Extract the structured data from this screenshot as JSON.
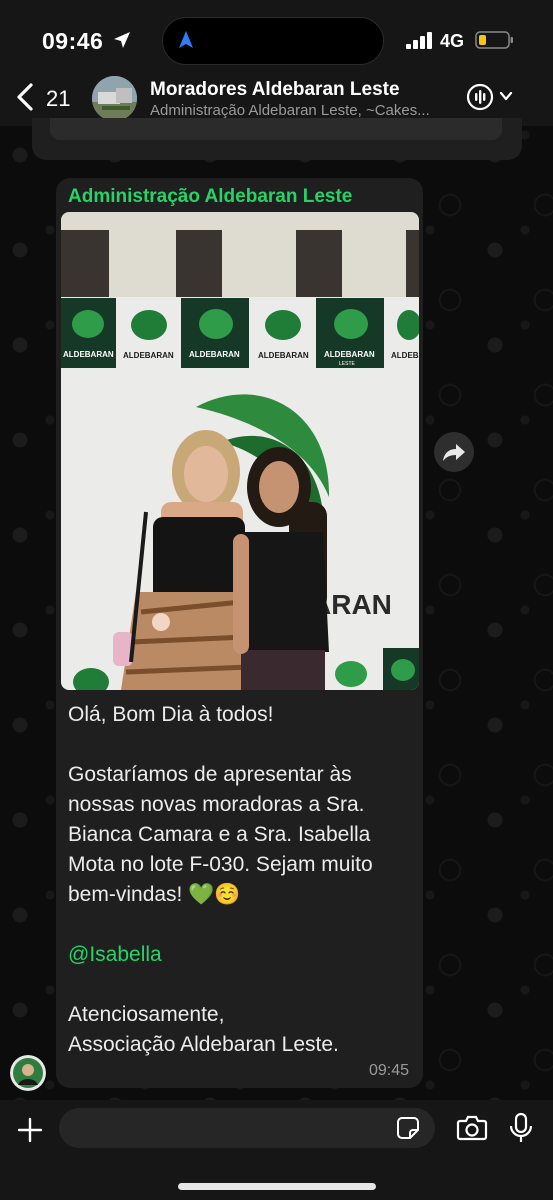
{
  "status_bar": {
    "time": "09:46",
    "network": "4G"
  },
  "header": {
    "back_count": "21",
    "group_name": "Moradores Aldebaran Leste",
    "subtitle": "Administração Aldebaran Leste, ~Cakes..."
  },
  "message": {
    "sender": "Administração Aldebaran Leste",
    "photo_banner_text": "ALDEBARAN",
    "photo_banner_subtext": "LESTE",
    "photo_wall_text": "ARAN",
    "lines": [
      "Olá, Bom Dia à todos!",
      "",
      "Gostaríamos de apresentar às nossas novas moradoras a Sra. Bianca Camara e a Sra. Isabella Mota  no lote F-030. Sejam muito bem-vindas! 💚☺️",
      "",
      "@Isabella",
      "",
      "Atenciosamente,\nAssociação Aldebaran Leste."
    ],
    "greeting": "Olá, Bom Dia à todos!",
    "body": "Gostaríamos de apresentar às nossas novas moradoras a Sra. Bianca Camara e a Sra. Isabella Mota  no lote F-030. Sejam muito bem-vindas! 💚☺️",
    "mention": "@Isabella",
    "signoff": "Atenciosamente,\nAssociação Aldebaran Leste.",
    "time": "09:45"
  },
  "input": {
    "value": "",
    "placeholder": ""
  },
  "colors": {
    "accent": "#25d366",
    "bubble": "#1f1f1f",
    "header": "#161616"
  },
  "icons": [
    "location-arrow-icon",
    "navigation-icon",
    "signal-icon",
    "battery-icon",
    "back-chevron-icon",
    "voice-call-icon",
    "chevron-down-icon",
    "forward-icon",
    "plus-icon",
    "sticker-icon",
    "camera-icon",
    "mic-icon"
  ]
}
